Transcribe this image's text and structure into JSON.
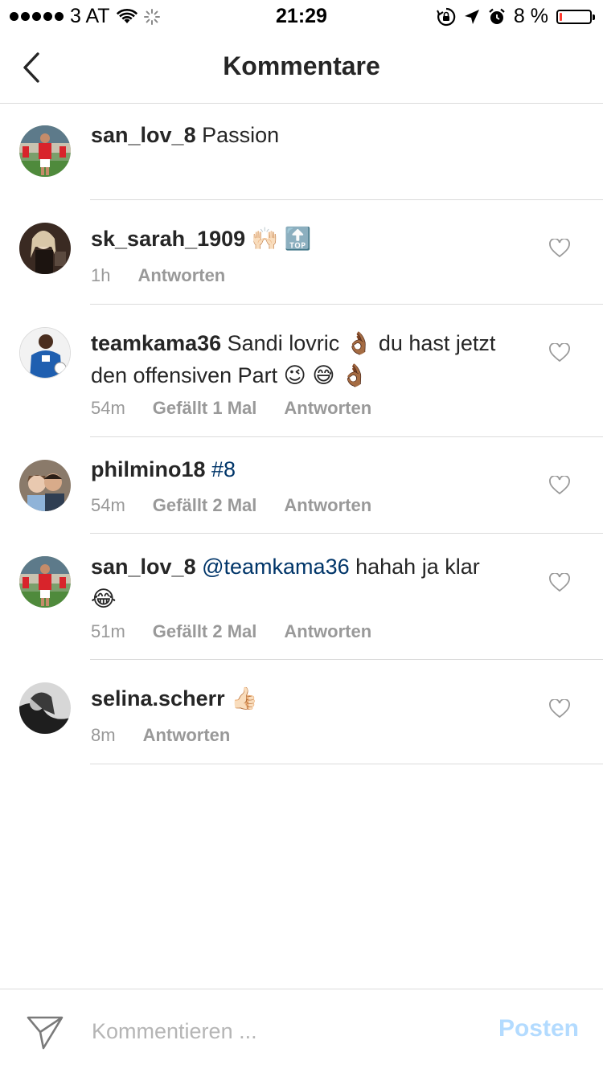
{
  "status_bar": {
    "carrier": "3 AT",
    "time": "21:29",
    "battery_percent": "8 %",
    "battery_level": 0.08
  },
  "nav": {
    "title": "Kommentare",
    "back_icon": "chevron-left-icon"
  },
  "comments": [
    {
      "username": "san_lov_8",
      "text": "Passion"
    },
    {
      "username": "sk_sarah_1909",
      "text": "🙌🏻 🔝",
      "time": "1h",
      "reply": "Antworten"
    },
    {
      "username": "teamkama36",
      "text": "Sandi lovric 👌🏾 du hast jetzt den offensiven Part 😉 😅 👌🏾",
      "time": "54m",
      "likes": "Gefällt 1 Mal",
      "reply": "Antworten"
    },
    {
      "username": "philmino18",
      "text": "#8",
      "time": "54m",
      "likes": "Gefällt 2 Mal",
      "reply": "Antworten"
    },
    {
      "username": "san_lov_8",
      "mention": "@teamkama36",
      "text": " hahah ja klar 😂",
      "time": "51m",
      "likes": "Gefällt 2 Mal",
      "reply": "Antworten"
    },
    {
      "username": "selina.scherr",
      "text": "👍🏻",
      "time": "8m",
      "reply": "Antworten"
    }
  ],
  "composer": {
    "placeholder": "Kommentieren ...",
    "value": "",
    "post_label": "Posten"
  },
  "colors": {
    "text": "#262626",
    "meta": "#999999",
    "link": "#003569",
    "post_disabled": "#b3dbff",
    "divider": "#dbdbdb",
    "battery_low": "#ff3b30"
  }
}
